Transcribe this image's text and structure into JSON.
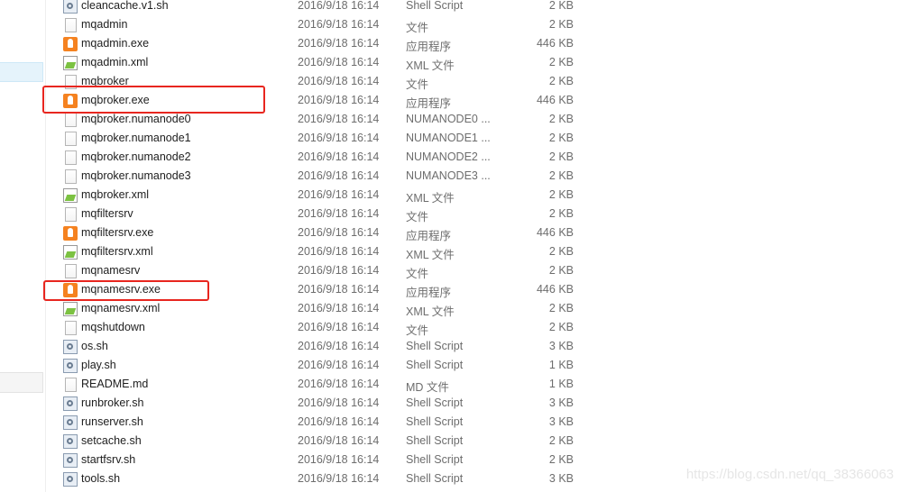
{
  "files": [
    {
      "name": "cleancache.v1.sh",
      "date": "2016/9/18 16:14",
      "type": "Shell Script",
      "size": "2 KB",
      "icon": "sh"
    },
    {
      "name": "mqadmin",
      "date": "2016/9/18 16:14",
      "type": "文件",
      "size": "2 KB",
      "icon": "doc"
    },
    {
      "name": "mqadmin.exe",
      "date": "2016/9/18 16:14",
      "type": "应用程序",
      "size": "446 KB",
      "icon": "exe"
    },
    {
      "name": "mqadmin.xml",
      "date": "2016/9/18 16:14",
      "type": "XML 文件",
      "size": "2 KB",
      "icon": "xml"
    },
    {
      "name": "mqbroker",
      "date": "2016/9/18 16:14",
      "type": "文件",
      "size": "2 KB",
      "icon": "doc"
    },
    {
      "name": "mqbroker.exe",
      "date": "2016/9/18 16:14",
      "type": "应用程序",
      "size": "446 KB",
      "icon": "exe",
      "highlighted": true
    },
    {
      "name": "mqbroker.numanode0",
      "date": "2016/9/18 16:14",
      "type": "NUMANODE0 ...",
      "size": "2 KB",
      "icon": "doc"
    },
    {
      "name": "mqbroker.numanode1",
      "date": "2016/9/18 16:14",
      "type": "NUMANODE1 ...",
      "size": "2 KB",
      "icon": "doc"
    },
    {
      "name": "mqbroker.numanode2",
      "date": "2016/9/18 16:14",
      "type": "NUMANODE2 ...",
      "size": "2 KB",
      "icon": "doc"
    },
    {
      "name": "mqbroker.numanode3",
      "date": "2016/9/18 16:14",
      "type": "NUMANODE3 ...",
      "size": "2 KB",
      "icon": "doc"
    },
    {
      "name": "mqbroker.xml",
      "date": "2016/9/18 16:14",
      "type": "XML 文件",
      "size": "2 KB",
      "icon": "xml"
    },
    {
      "name": "mqfiltersrv",
      "date": "2016/9/18 16:14",
      "type": "文件",
      "size": "2 KB",
      "icon": "doc"
    },
    {
      "name": "mqfiltersrv.exe",
      "date": "2016/9/18 16:14",
      "type": "应用程序",
      "size": "446 KB",
      "icon": "exe"
    },
    {
      "name": "mqfiltersrv.xml",
      "date": "2016/9/18 16:14",
      "type": "XML 文件",
      "size": "2 KB",
      "icon": "xml"
    },
    {
      "name": "mqnamesrv",
      "date": "2016/9/18 16:14",
      "type": "文件",
      "size": "2 KB",
      "icon": "doc"
    },
    {
      "name": "mqnamesrv.exe",
      "date": "2016/9/18 16:14",
      "type": "应用程序",
      "size": "446 KB",
      "icon": "exe",
      "highlighted": true
    },
    {
      "name": "mqnamesrv.xml",
      "date": "2016/9/18 16:14",
      "type": "XML 文件",
      "size": "2 KB",
      "icon": "xml"
    },
    {
      "name": "mqshutdown",
      "date": "2016/9/18 16:14",
      "type": "文件",
      "size": "2 KB",
      "icon": "doc"
    },
    {
      "name": "os.sh",
      "date": "2016/9/18 16:14",
      "type": "Shell Script",
      "size": "3 KB",
      "icon": "sh"
    },
    {
      "name": "play.sh",
      "date": "2016/9/18 16:14",
      "type": "Shell Script",
      "size": "1 KB",
      "icon": "sh"
    },
    {
      "name": "README.md",
      "date": "2016/9/18 16:14",
      "type": "MD 文件",
      "size": "1 KB",
      "icon": "doc"
    },
    {
      "name": "runbroker.sh",
      "date": "2016/9/18 16:14",
      "type": "Shell Script",
      "size": "3 KB",
      "icon": "sh"
    },
    {
      "name": "runserver.sh",
      "date": "2016/9/18 16:14",
      "type": "Shell Script",
      "size": "3 KB",
      "icon": "sh"
    },
    {
      "name": "setcache.sh",
      "date": "2016/9/18 16:14",
      "type": "Shell Script",
      "size": "2 KB",
      "icon": "sh"
    },
    {
      "name": "startfsrv.sh",
      "date": "2016/9/18 16:14",
      "type": "Shell Script",
      "size": "2 KB",
      "icon": "sh"
    },
    {
      "name": "tools.sh",
      "date": "2016/9/18 16:14",
      "type": "Shell Script",
      "size": "3 KB",
      "icon": "sh"
    }
  ],
  "highlight_color": "#e8261f",
  "watermark": "https://blog.csdn.net/qq_38366063"
}
